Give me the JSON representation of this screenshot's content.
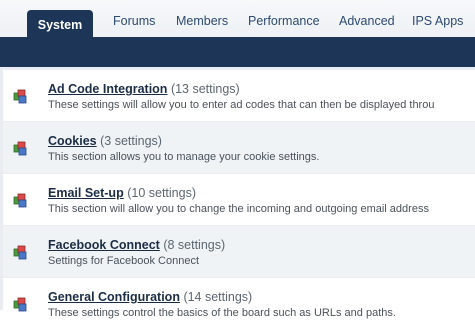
{
  "tabs": [
    {
      "label": "System",
      "active": true
    },
    {
      "label": "Forums"
    },
    {
      "label": "Members"
    },
    {
      "label": "Performance"
    },
    {
      "label": "Advanced"
    },
    {
      "label": "IPS Apps"
    }
  ],
  "settings": [
    {
      "title": "Ad Code Integration",
      "count": "(13 settings)",
      "description": "These settings will allow you to enter ad codes that can then be displayed throu"
    },
    {
      "title": "Cookies",
      "count": "(3 settings)",
      "description": "This section allows you to manage your cookie settings."
    },
    {
      "title": "Email Set-up",
      "count": "(10 settings)",
      "description": "This section will allow you to change the incoming and outgoing email address"
    },
    {
      "title": "Facebook Connect",
      "count": "(8 settings)",
      "description": "Settings for Facebook Connect"
    },
    {
      "title": "General Configuration",
      "count": "(14 settings)",
      "description": "These settings control the basics of the board such as URLs and paths."
    }
  ],
  "icon": "settings-cubes-icon",
  "colors": {
    "nav": "#1d3657",
    "tab_text": "#2d4a70",
    "row_alt": "#f0f3f6"
  }
}
